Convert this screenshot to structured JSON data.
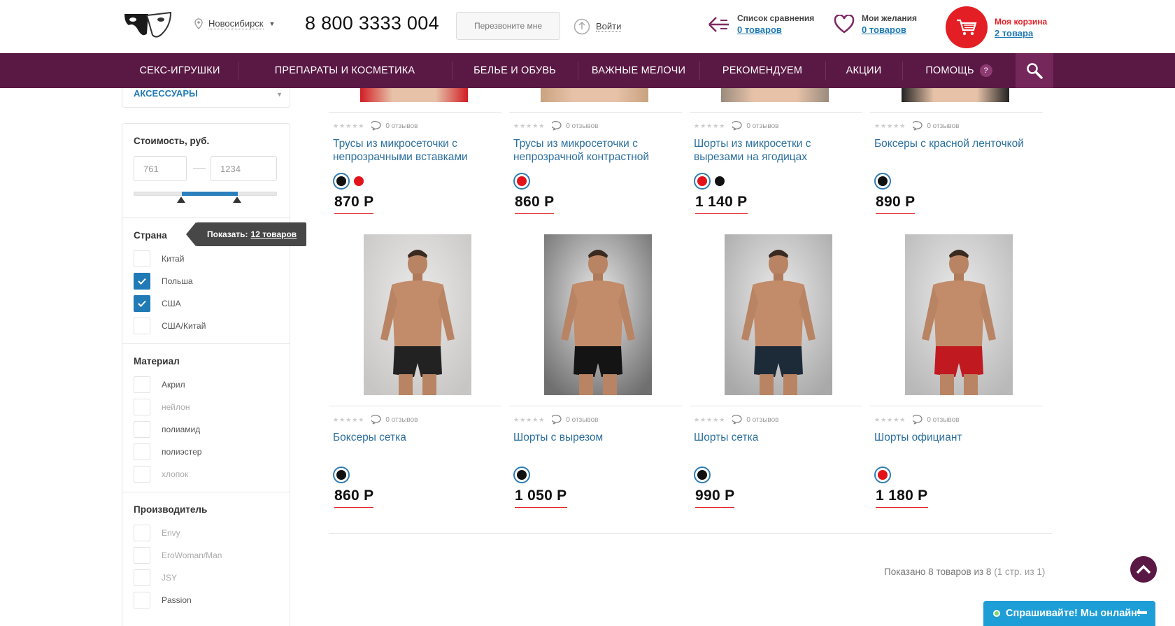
{
  "header": {
    "city": "Новосибирск",
    "phone": "8 800 3333 004",
    "callback_label": "Перезвоните мне",
    "login_label": "Войти",
    "compare_title": "Список сравнения",
    "compare_count": "0 товаров",
    "wishlist_title": "Мои желания",
    "wishlist_count": "0 товаров",
    "cart_title": "Моя корзина",
    "cart_count": "2 товара"
  },
  "nav": {
    "items": [
      {
        "label": "СЕКС-ИГРУШКИ"
      },
      {
        "label": "ПРЕПАРАТЫ И КОСМЕТИКА"
      },
      {
        "label": "БЕЛЬЕ И ОБУВЬ"
      },
      {
        "label": "ВАЖНЫЕ МЕЛОЧИ"
      },
      {
        "label": "РЕКОМЕНДУЕМ"
      },
      {
        "label": "АКЦИИ"
      },
      {
        "label": "ПОМОЩЬ"
      }
    ],
    "help_badge": "?"
  },
  "sidebar": {
    "category_label": "АКСЕССУАРЫ",
    "price": {
      "title": "Стоимость, руб.",
      "min": "761",
      "max": "1234",
      "range_from": 0.33,
      "range_to": 0.72
    },
    "country": {
      "title": "Страна",
      "options": [
        {
          "label": "Китай",
          "checked": false
        },
        {
          "label": "Польша",
          "checked": true
        },
        {
          "label": "США",
          "checked": true
        },
        {
          "label": "США/Китай",
          "checked": false
        }
      ]
    },
    "tooltip": {
      "label": "Показать:",
      "count": "12 товаров"
    },
    "material": {
      "title": "Материал",
      "options": [
        {
          "label": "Акрил",
          "enabled": true
        },
        {
          "label": "нейлон",
          "enabled": false
        },
        {
          "label": "полиамид",
          "enabled": true
        },
        {
          "label": "полиэстер",
          "enabled": true
        },
        {
          "label": "хлопок",
          "enabled": false
        }
      ]
    },
    "manufacturer": {
      "title": "Производитель",
      "options": [
        {
          "label": "Envy",
          "enabled": false
        },
        {
          "label": "EroWoman/Man",
          "enabled": false
        },
        {
          "label": "JSY",
          "enabled": false
        },
        {
          "label": "Passion",
          "enabled": true
        }
      ]
    }
  },
  "products": [
    {
      "name": "Трусы из микросеточки с непрозрачными вставками",
      "reviews": "0 отзывов",
      "price": "870 Р",
      "colors": [
        "#111111",
        "#e3131b"
      ]
    },
    {
      "name": "Трусы из микросеточки с непрозрачной контрастной",
      "reviews": "0 отзывов",
      "price": "860 Р",
      "colors": [
        "#e3131b"
      ]
    },
    {
      "name": "Шорты из микросетки с вырезами на ягодицах",
      "reviews": "0 отзывов",
      "price": "1 140 Р",
      "colors": [
        "#e3131b",
        "#111111"
      ]
    },
    {
      "name": "Боксеры с красной ленточкой",
      "reviews": "0 отзывов",
      "price": "890 Р",
      "colors": [
        "#111111"
      ]
    },
    {
      "name": "Боксеры сетка",
      "reviews": "0 отзывов",
      "price": "860 Р",
      "colors": [
        "#111111"
      ]
    },
    {
      "name": "Шорты с вырезом",
      "reviews": "0 отзывов",
      "price": "1 050 Р",
      "colors": [
        "#111111"
      ]
    },
    {
      "name": "Шорты сетка",
      "reviews": "0 отзывов",
      "price": "990 Р",
      "colors": [
        "#111111"
      ]
    },
    {
      "name": "Шорты официант",
      "reviews": "0 отзывов",
      "price": "1 180 Р",
      "colors": [
        "#e3131b"
      ]
    }
  ],
  "pagination": {
    "shown": "Показано 8 товаров из 8",
    "pages": "(1 стр. из 1)"
  },
  "chat": {
    "label": "Спрашивайте! Мы онлайн!"
  },
  "colors": {
    "brand": "#5a1844",
    "accent": "#e31e24",
    "link": "#1f7ab5",
    "chat": "#1e9ed6"
  }
}
